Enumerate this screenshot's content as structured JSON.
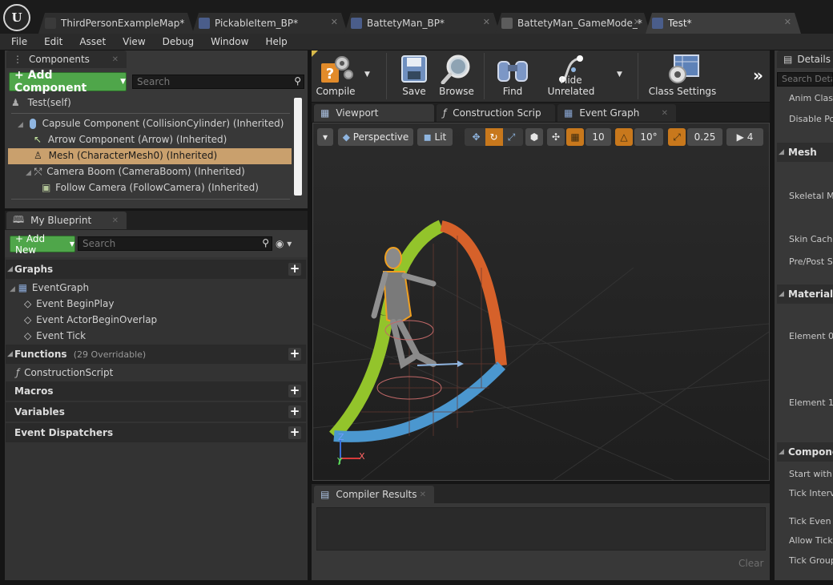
{
  "app": {
    "logo": "U"
  },
  "doc_tabs": [
    {
      "label": "ThirdPersonExampleMap*"
    },
    {
      "label": "PickableItem_BP*"
    },
    {
      "label": "BattetyMan_BP*"
    },
    {
      "label": "BattetyMan_GameMode_*"
    },
    {
      "label": "Test*"
    }
  ],
  "menu": [
    "File",
    "Edit",
    "Asset",
    "View",
    "Debug",
    "Window",
    "Help"
  ],
  "components": {
    "tab": "Components",
    "add_button": "+ Add Component",
    "search_placeholder": "Search",
    "self": "Test(self)",
    "items": [
      "Capsule Component (CollisionCylinder) (Inherited)",
      "Arrow Component (Arrow) (Inherited)",
      "Mesh (CharacterMesh0) (Inherited)",
      "Camera Boom (CameraBoom) (Inherited)",
      "Follow Camera (FollowCamera) (Inherited)"
    ],
    "selected_index": 2
  },
  "my_blueprint": {
    "tab": "My Blueprint",
    "add_button": "+ Add New",
    "search_placeholder": "Search",
    "graphs_label": "Graphs",
    "event_graph": "EventGraph",
    "events": [
      "Event BeginPlay",
      "Event ActorBeginOverlap",
      "Event Tick"
    ],
    "functions_label": "Functions",
    "functions_note": "(29 Overridable)",
    "functions": [
      "ConstructionScript"
    ],
    "macros_label": "Macros",
    "variables_label": "Variables",
    "dispatchers_label": "Event Dispatchers"
  },
  "toolbar": {
    "compile": "Compile",
    "save": "Save",
    "browse": "Browse",
    "find": "Find",
    "hide_unrelated": "Hide Unrelated",
    "class_settings": "Class Settings"
  },
  "editor_tabs": [
    "Viewport",
    "Construction Scrip",
    "Event Graph"
  ],
  "viewport": {
    "perspective": "Perspective",
    "lit": "Lit",
    "grid_snap": "10",
    "rotation_snap": "10°",
    "scale_snap": "0.25",
    "camera_speed": "4",
    "axis_z": "Z",
    "axis_x": "X",
    "axis_y": "Y"
  },
  "compiler": {
    "tab": "Compiler Results",
    "clear": "Clear"
  },
  "details": {
    "tab": "Details",
    "search_placeholder": "Search Deta",
    "rows_top": [
      "Anim Class",
      "Disable Pos"
    ],
    "mesh_header": "Mesh",
    "mesh_rows": [
      "Skeletal Me",
      "Skin Cache",
      "Pre/Post S"
    ],
    "materials_header": "Materials",
    "material_rows": [
      "Element 0",
      "Element 1"
    ],
    "component_header": "Componen",
    "component_rows": [
      "Start with T",
      "Tick Interva",
      "Tick Even v",
      "Allow Tick",
      "Tick Group"
    ]
  },
  "colors": {
    "accent_green": "#4fa64a",
    "selection": "#c9a06d",
    "toolbar_snap_active": "#c8781c"
  }
}
